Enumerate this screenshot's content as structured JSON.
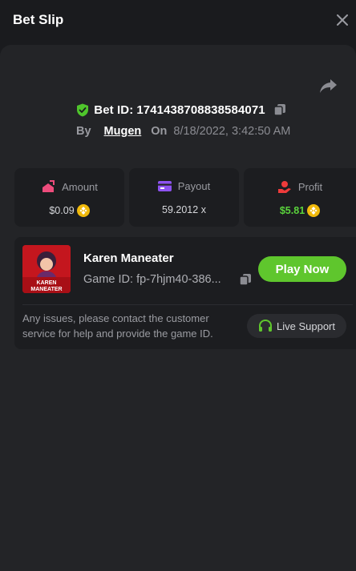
{
  "header": {
    "title": "Bet Slip"
  },
  "bet": {
    "bet_id_label": "Bet ID:",
    "bet_id": "1741438708838584071",
    "by_label": "By",
    "user": "Mugen",
    "on_label": "On",
    "date": "8/18/2022, 3:42:50 AM"
  },
  "stats": {
    "amount": {
      "label": "Amount",
      "value": "$0.09",
      "icon": "wallet-arrow-icon",
      "color": "#ee4c7c"
    },
    "payout": {
      "label": "Payout",
      "value": "59.2012 x",
      "icon": "card-icon",
      "color": "#8d52f0"
    },
    "profit": {
      "label": "Profit",
      "value": "$5.81",
      "icon": "hand-coin-icon",
      "color": "#ee3b3b",
      "value_color": "#5ad33c"
    }
  },
  "game": {
    "name": "Karen Maneater",
    "thumb_text": "KAREN MANEATER",
    "id_label": "Game ID:",
    "id": "fp-7hjm40-386...",
    "play_label": "Play Now",
    "notice": "Any issues, please contact the customer service for help and provide the game ID.",
    "support_label": "Live Support"
  },
  "colors": {
    "background": "#1a1b1e",
    "panel": "#232427",
    "card": "#1c1d20",
    "accent_green": "#5fc62d",
    "coin": "#f0b90b"
  }
}
